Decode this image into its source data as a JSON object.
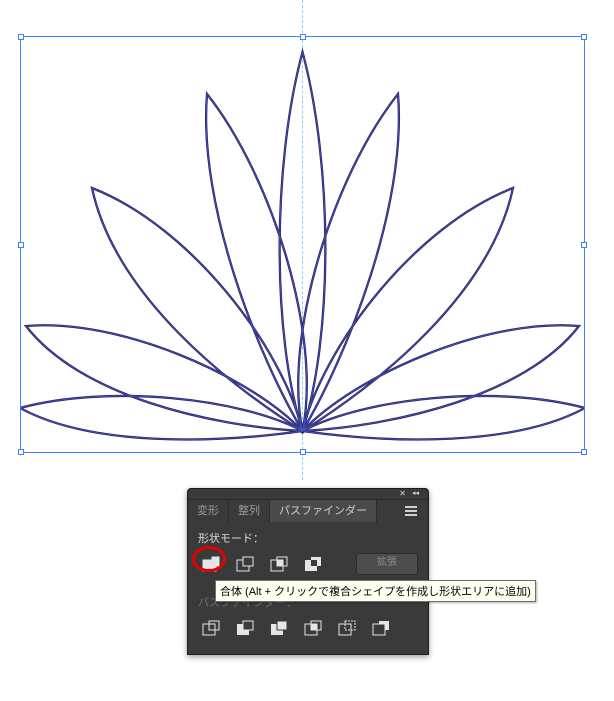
{
  "canvas": {
    "guide_axis": "vertical",
    "selection": "lotus-outline-paths"
  },
  "panel": {
    "tabs": [
      {
        "id": "transform",
        "label": "変形",
        "active": false
      },
      {
        "id": "align",
        "label": "整列",
        "active": false
      },
      {
        "id": "pathfinder",
        "label": "パスファインダー",
        "active": true
      }
    ],
    "shape_modes": {
      "label": "形状モード：",
      "buttons": [
        {
          "id": "unite",
          "name": "合体"
        },
        {
          "id": "minus",
          "name": "前面オブジェクトで型抜き"
        },
        {
          "id": "intersect",
          "name": "交差"
        },
        {
          "id": "exclude",
          "name": "中マド"
        }
      ],
      "expand_label": "拡張"
    },
    "pathfinders": {
      "label": "パスファインダー：",
      "buttons": [
        {
          "id": "divide",
          "name": "分割"
        },
        {
          "id": "trim",
          "name": "刈り込み"
        },
        {
          "id": "merge",
          "name": "合流"
        },
        {
          "id": "crop",
          "name": "切り抜き"
        },
        {
          "id": "outline",
          "name": "アウトライン"
        },
        {
          "id": "minus-back",
          "name": "背面オブジェクトで型抜き"
        }
      ]
    }
  },
  "tooltip": {
    "text": "合体 (Alt + クリックで複合シェイプを作成し形状エリアに追加)"
  },
  "callout": {
    "target": "unite"
  },
  "colors": {
    "selection": "#3f80ff",
    "panel_bg": "#3a3a3a",
    "callout": "#e60000",
    "stroke": "#2b2466"
  }
}
